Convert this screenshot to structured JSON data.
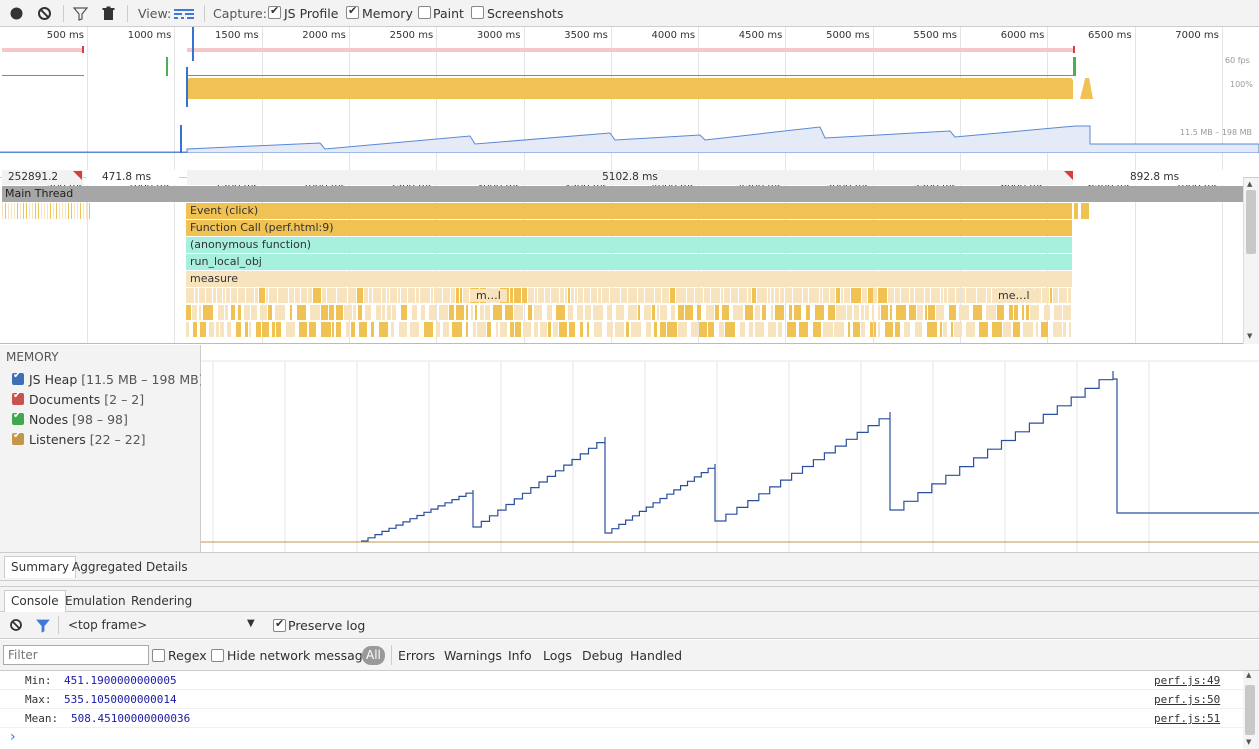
{
  "toolbar": {
    "view_label": "View:",
    "capture_label": "Capture:",
    "js_profile": "JS Profile",
    "memory": "Memory",
    "paint": "Paint",
    "screenshots": "Screenshots",
    "js_profile_checked": true,
    "memory_checked": true,
    "paint_checked": false,
    "screenshots_checked": false
  },
  "ruler": {
    "ticks": [
      "500 ms",
      "1000 ms",
      "1500 ms",
      "2000 ms",
      "2500 ms",
      "3000 ms",
      "3500 ms",
      "4000 ms",
      "4500 ms",
      "5000 ms",
      "5500 ms",
      "6000 ms",
      "6500 ms",
      "7000 ms"
    ],
    "fps_label": "60 fps",
    "cpu_label": "100%",
    "heap_label": "11.5 MB – 198 MB"
  },
  "frames": {
    "first": "252891.2 ms",
    "second": "471.8 ms",
    "main": "5102.8 ms",
    "last": "892.8 ms"
  },
  "flame": {
    "thread_label": "Main Thread",
    "event": "Event (click)",
    "function_call": "Function Call (perf.html:9)",
    "anonymous": "(anonymous function)",
    "run_local": "run_local_obj",
    "measure": "measure",
    "m1": "m…l",
    "m2": "me…l"
  },
  "memory": {
    "title": "MEMORY",
    "counters": [
      {
        "label": "JS Heap",
        "range": "[11.5 MB – 198 MB]",
        "color": "#3e6fb5"
      },
      {
        "label": "Documents",
        "range": "[2 – 2]",
        "color": "#c8524f"
      },
      {
        "label": "Nodes",
        "range": "[98 – 98]",
        "color": "#41a84e"
      },
      {
        "label": "Listeners",
        "range": "[22 – 22]",
        "color": "#c3974a"
      }
    ]
  },
  "details_tabs": {
    "summary": "Summary",
    "aggregated": "Aggregated Details"
  },
  "drawer_tabs": {
    "console": "Console",
    "emulation": "Emulation",
    "rendering": "Rendering"
  },
  "console": {
    "frame_select": "<top frame>",
    "preserve_log": "Preserve log",
    "filter_placeholder": "Filter",
    "regex": "Regex",
    "hide_network": "Hide network messages",
    "levels": [
      "All",
      "Errors",
      "Warnings",
      "Info",
      "Logs",
      "Debug",
      "Handled"
    ],
    "messages": [
      {
        "key": "Min:",
        "value": "451.1900000000005",
        "source": "perf.js:49"
      },
      {
        "key": "Max:",
        "value": "535.1050000000014",
        "source": "perf.js:50"
      },
      {
        "key": "Mean:",
        "value": "508.45100000000036",
        "source": "perf.js:51"
      }
    ],
    "prompt": "›"
  }
}
